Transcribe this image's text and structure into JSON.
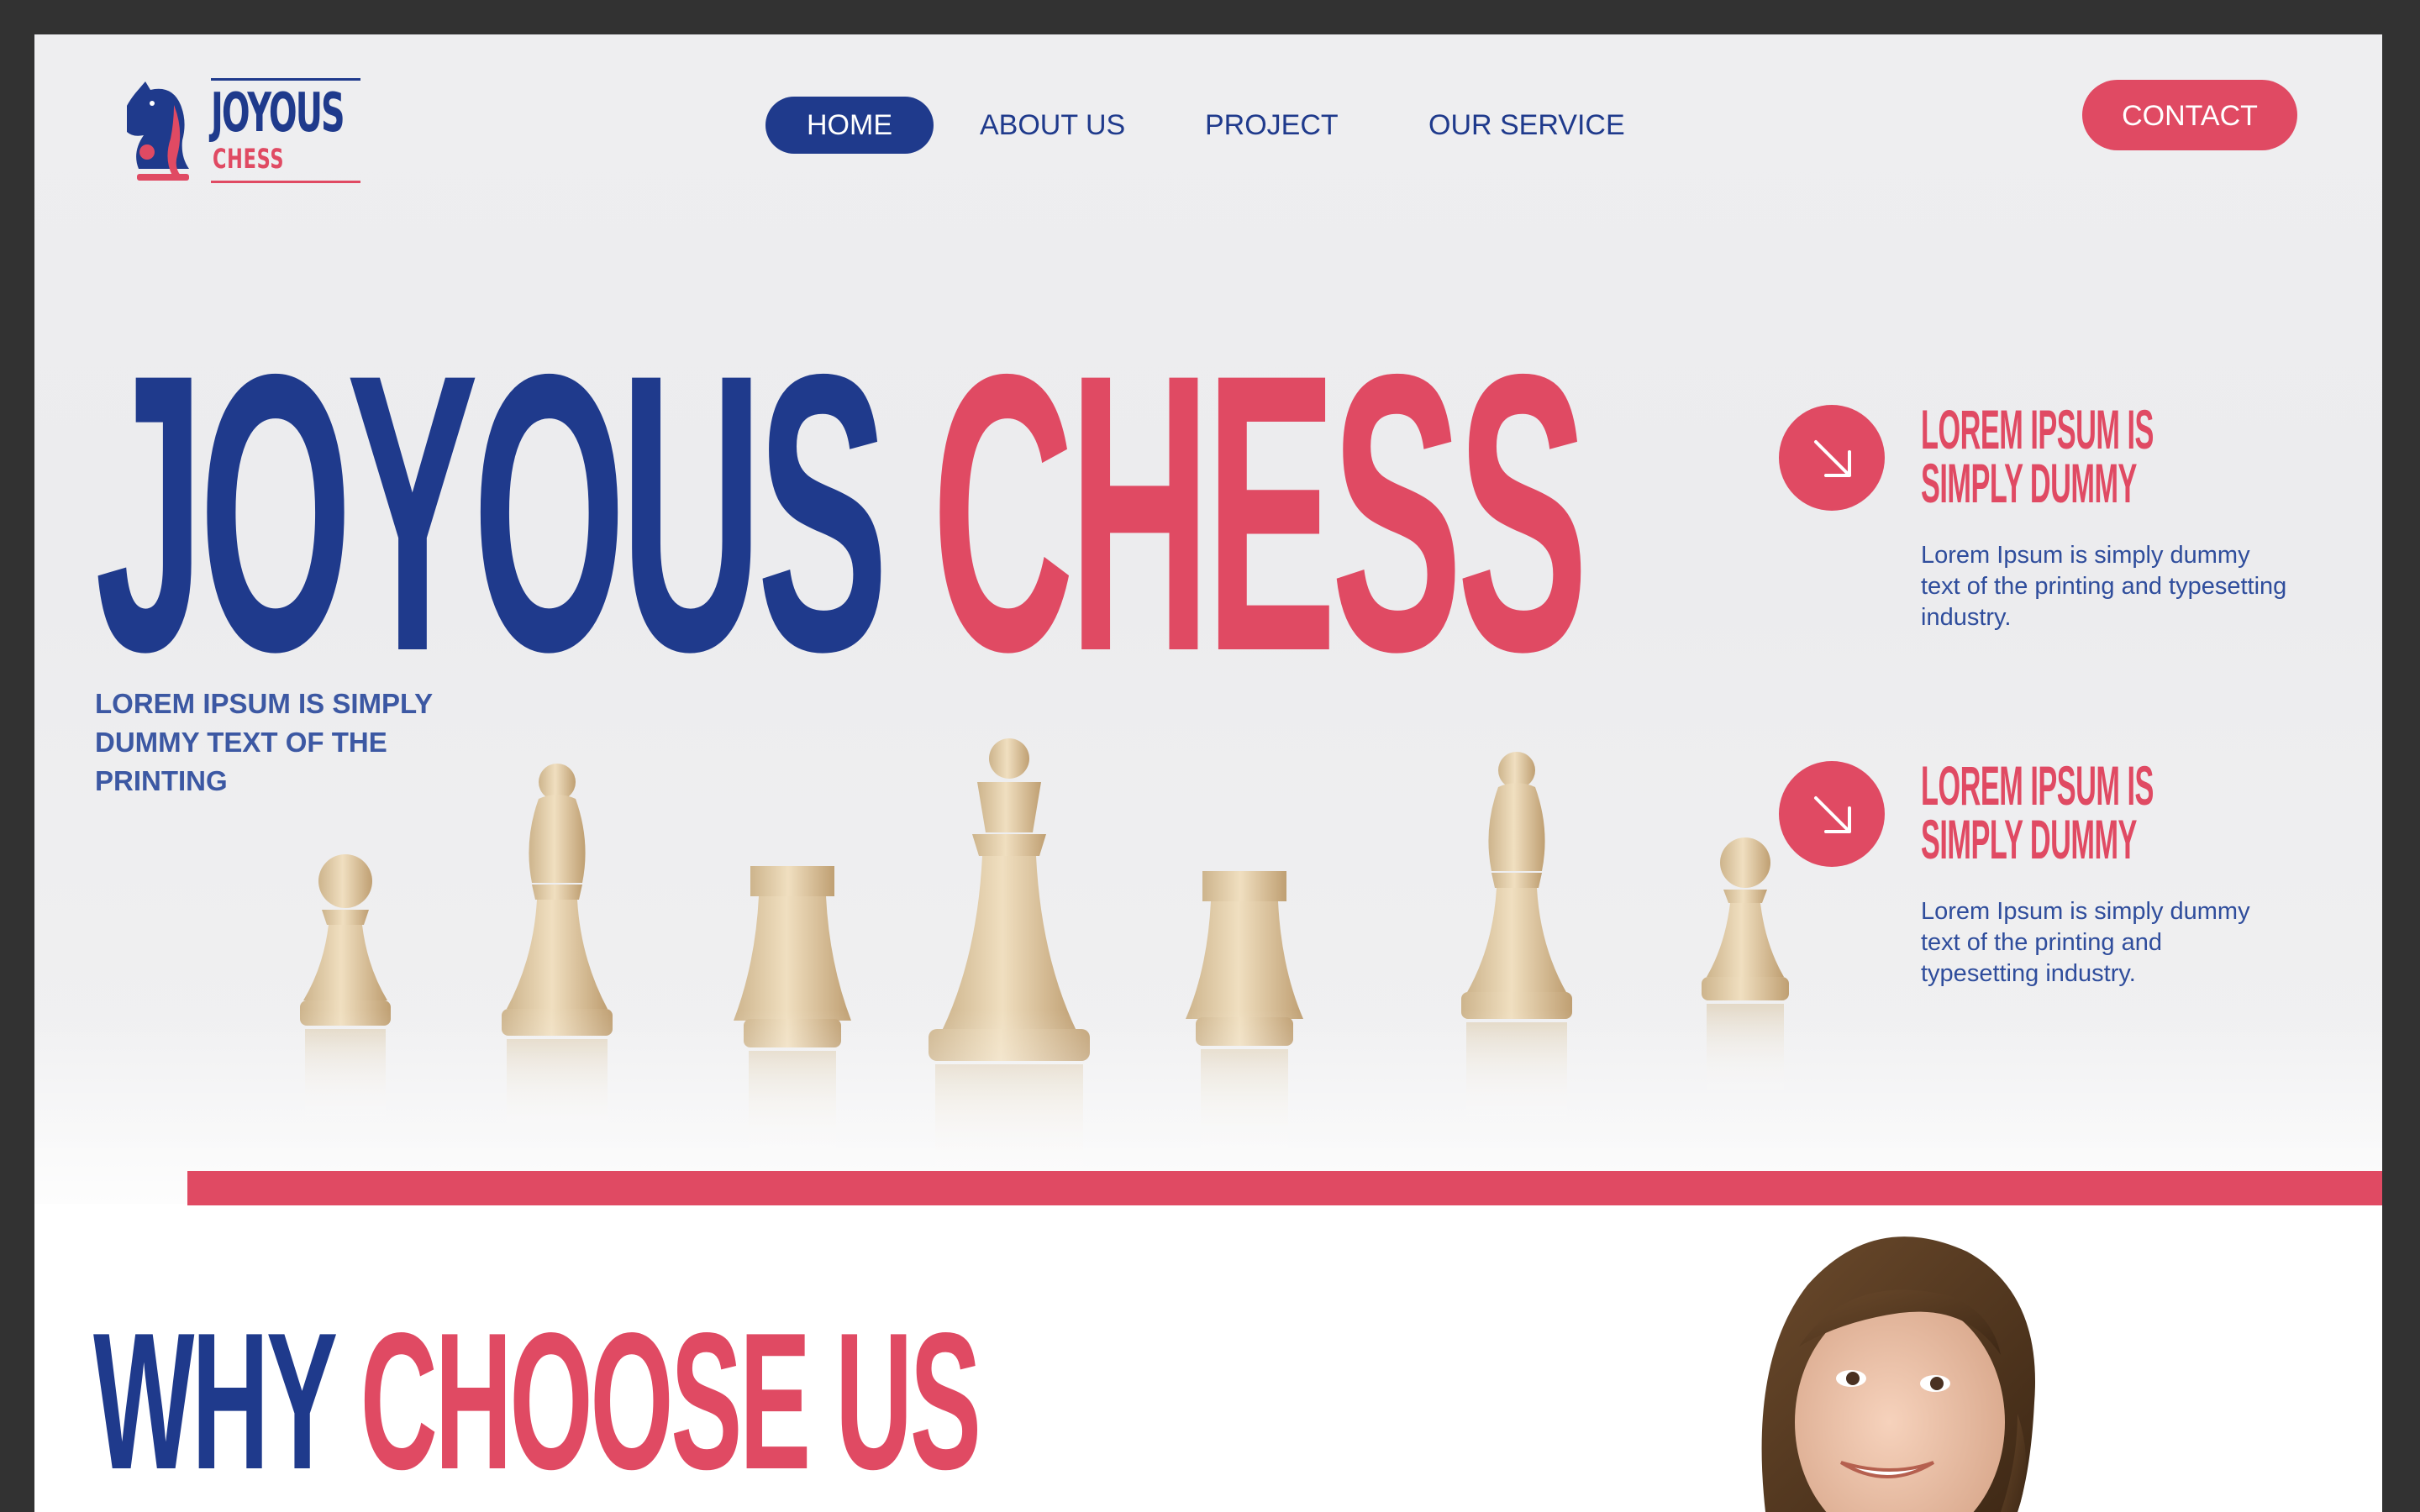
{
  "colors": {
    "brand_blue": "#1f3a8c",
    "brand_red": "#e04a63",
    "frame": "#323232"
  },
  "logo": {
    "word": "JOYOUS",
    "sub": "CHESS",
    "icon": "knight-icon"
  },
  "nav": {
    "items": [
      {
        "label": "HOME",
        "active": true
      },
      {
        "label": "ABOUT US",
        "active": false
      },
      {
        "label": "PROJECT",
        "active": false
      },
      {
        "label": "OUR SERVICE",
        "active": false
      }
    ],
    "contact_label": "CONTACT"
  },
  "hero": {
    "headline_part1": "JOYOUS",
    "headline_part2": "CHESS",
    "tagline": "LOREM IPSUM IS SIMPLY DUMMY TEXT OF THE PRINTING",
    "image": "wooden-chess-pieces-photo"
  },
  "features": [
    {
      "icon": "arrow-down-right-icon",
      "title": "LOREM IPSUM IS SIMPLY DUMMY",
      "text": "Lorem Ipsum is simply dummy text of the printing and typesetting industry."
    },
    {
      "icon": "arrow-down-right-icon",
      "title": "LOREM IPSUM IS SIMPLY DUMMY",
      "text": "Lorem Ipsum is simply dummy text of the printing and typesetting industry."
    }
  ],
  "why": {
    "part1": "WHY",
    "part2": "CHOOSE US",
    "image": "smiling-girl-photo"
  }
}
